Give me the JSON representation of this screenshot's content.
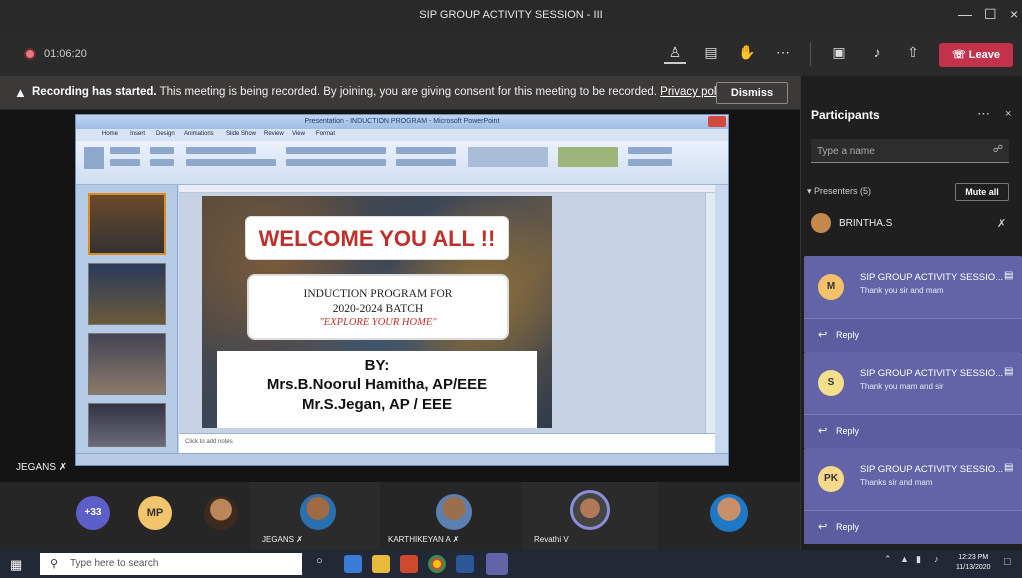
{
  "window": {
    "title": "SIP GROUP ACTIVITY SESSION - III"
  },
  "toolbar": {
    "timer": "01:06:20",
    "leave_label": "Leave"
  },
  "banner": {
    "bold": "Recording has started.",
    "text": "This meeting is being recorded. By joining, you are giving consent for this meeting to be recorded.",
    "link": "Privacy policy",
    "dismiss": "Dismiss"
  },
  "stage": {
    "presenter_name": "JEGANS"
  },
  "ppt": {
    "title": "Presentation - INDUCTION PROGRAM - Microsoft PowerPoint",
    "tabs": [
      "Home",
      "Insert",
      "Design",
      "Animations",
      "Slide Show",
      "Review",
      "View",
      "Format"
    ],
    "notes_placeholder": "Click to add notes"
  },
  "slide": {
    "welcome": "WELCOME YOU ALL !!",
    "induction_l1": "INDUCTION PROGRAM FOR",
    "induction_l2": "2020-2024 BATCH",
    "induction_l3": "\"EXPLORE YOUR HOME\"",
    "by": "BY:",
    "presenter1": "Mrs.B.Noorul Hamitha, AP/EEE",
    "presenter2": "Mr.S.Jegan, AP / EEE"
  },
  "strip": {
    "overflow_count": "+33",
    "mp_initials": "MP",
    "tile_names": [
      "JEGANS",
      "KARTHIKEYAN A",
      "Revathi V"
    ]
  },
  "panel": {
    "title": "Participants",
    "search_placeholder": "Type a name",
    "presenters_label": "Presenters (5)",
    "mute_all": "Mute all",
    "first_presenter": "BRINTHA.S"
  },
  "notifications": [
    {
      "initials": "M",
      "title": "SIP GROUP ACTIVITY SESSIO...",
      "message": "Thank you sir and mam",
      "reply": "Reply",
      "color": "#f3c16a"
    },
    {
      "initials": "S",
      "title": "SIP GROUP ACTIVITY SESSIO...",
      "message": "Thank you mam and sir",
      "reply": "Reply",
      "color": "#f3e08a"
    },
    {
      "initials": "PK",
      "title": "SIP GROUP ACTIVITY SESSIO...",
      "message": "Thanks sir and mam",
      "reply": "Reply",
      "color": "#f6d98a"
    }
  ],
  "taskbar": {
    "search_placeholder": "Type here to search",
    "time": "12:23 PM",
    "date": "11/13/2020"
  }
}
